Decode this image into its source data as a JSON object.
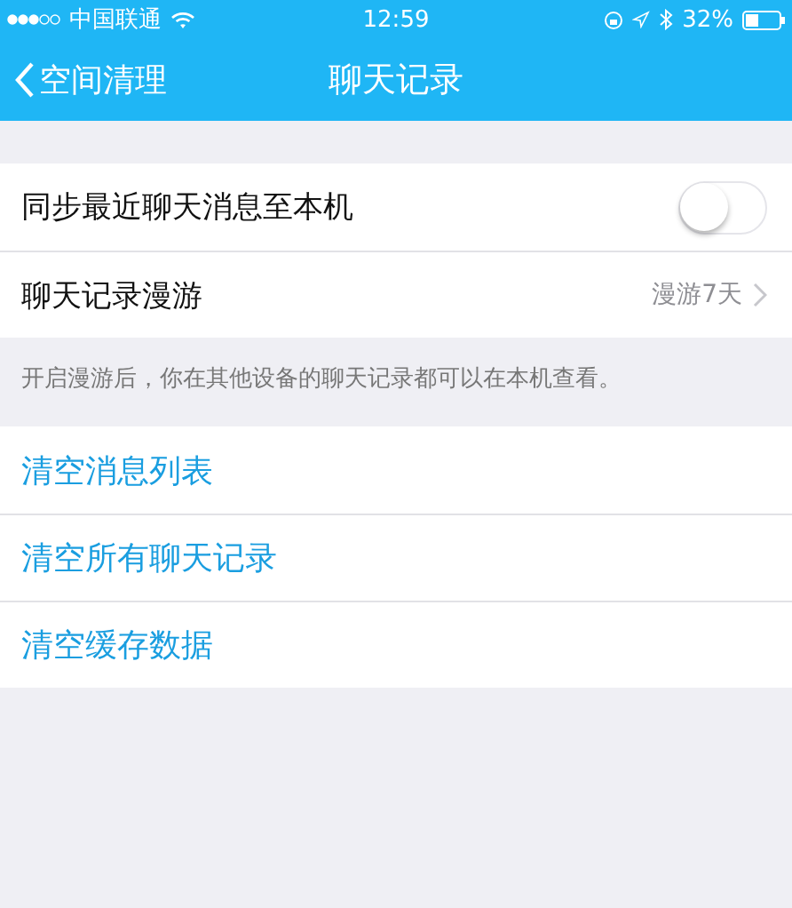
{
  "status_bar": {
    "carrier": "中国联通",
    "time": "12:59",
    "battery": "32%"
  },
  "nav": {
    "back_label": "空间清理",
    "title": "聊天记录"
  },
  "settings": [
    {
      "kind": "toggle",
      "label": "同步最近聊天消息至本机",
      "on": false
    },
    {
      "kind": "link",
      "label": "聊天记录漫游",
      "value": "漫游7天"
    }
  ],
  "note": "开启漫游后，你在其他设备的聊天记录都可以在本机查看。",
  "actions": [
    "清空消息列表",
    "清空所有聊天记录",
    "清空缓存数据"
  ]
}
